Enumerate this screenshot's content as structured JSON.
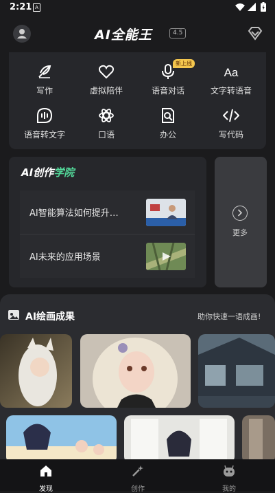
{
  "status_bar": {
    "time": "2:21",
    "notification_icon": "A",
    "icons": [
      "wifi-icon",
      "signal-icon",
      "battery-icon"
    ]
  },
  "header": {
    "logo_text": "AI全能王",
    "version": "4.5"
  },
  "tools": [
    {
      "label": "写作",
      "icon": "pen-icon"
    },
    {
      "label": "虚拟陪伴",
      "icon": "heart-icon"
    },
    {
      "label": "语音对话",
      "icon": "microphone-icon",
      "badge": "新上线"
    },
    {
      "label": "文字转语音",
      "icon": "text-aa-icon"
    },
    {
      "label": "语音转文字",
      "icon": "voice-wave-icon"
    },
    {
      "label": "口语",
      "icon": "atom-icon"
    },
    {
      "label": "办公",
      "icon": "document-search-icon"
    },
    {
      "label": "写代码",
      "icon": "code-icon"
    }
  ],
  "academy": {
    "title_prefix": "AI创作",
    "title_highlight": "学院",
    "courses": [
      {
        "title": "AI智能算法如何提升…"
      },
      {
        "title": "AI未来的应用场景"
      }
    ],
    "more_label": "更多"
  },
  "gallery": {
    "title": "AI绘画成果",
    "subtitle": "助你快速一语成画!"
  },
  "tabbar": [
    {
      "label": "发现",
      "icon": "home-icon",
      "active": true
    },
    {
      "label": "创作",
      "icon": "magic-wand-icon",
      "active": false
    },
    {
      "label": "我的",
      "icon": "robot-face-icon",
      "active": false
    }
  ],
  "colors": {
    "background": "#1b1b1d",
    "card": "#26272b",
    "accent_green": "#53d99a",
    "badge_yellow": "#f3c64e"
  }
}
